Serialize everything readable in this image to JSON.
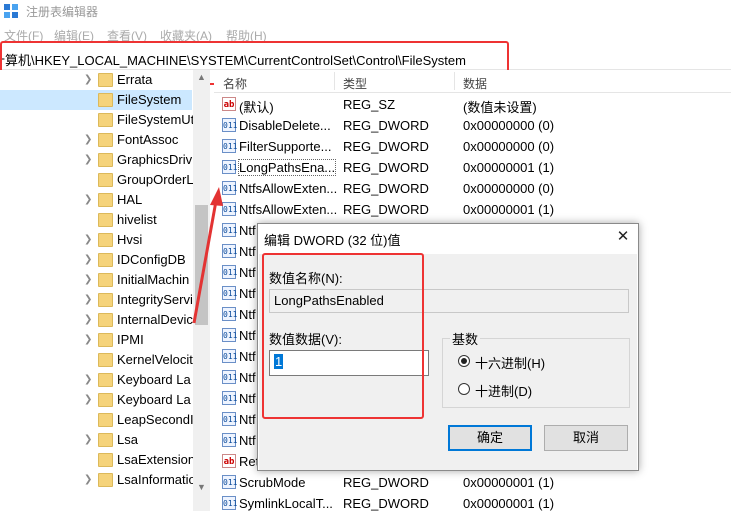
{
  "window": {
    "title": "注册表编辑器",
    "menu": [
      "文件(F)",
      "编辑(E)",
      "查看(V)",
      "收藏夹(A)",
      "帮助(H)"
    ]
  },
  "address": {
    "path": "计算机\\HKEY_LOCAL_MACHINE\\SYSTEM\\CurrentControlSet\\Control\\FileSystem"
  },
  "tree": {
    "items": [
      {
        "label": "Errata"
      },
      {
        "label": "FileSystem"
      },
      {
        "label": "FileSystemUti"
      },
      {
        "label": "FontAssoc"
      },
      {
        "label": "GraphicsDriv"
      },
      {
        "label": "GroupOrderL"
      },
      {
        "label": "HAL"
      },
      {
        "label": "hivelist"
      },
      {
        "label": "Hvsi"
      },
      {
        "label": "IDConfigDB"
      },
      {
        "label": "InitialMachin"
      },
      {
        "label": "IntegrityServi"
      },
      {
        "label": "InternalDevic"
      },
      {
        "label": "IPMI"
      },
      {
        "label": "KernelVelocit"
      },
      {
        "label": "Keyboard La"
      },
      {
        "label": "Keyboard La"
      },
      {
        "label": "LeapSecondI"
      },
      {
        "label": "Lsa"
      },
      {
        "label": "LsaExtension"
      },
      {
        "label": "LsaInformatio"
      }
    ]
  },
  "list": {
    "headers": {
      "name": "名称",
      "type": "类型",
      "data": "数据"
    },
    "rows": [
      {
        "icon": "ab",
        "name": "(默认)",
        "type": "REG_SZ",
        "data": "(数值未设置)"
      },
      {
        "icon": "dword",
        "name": "DisableDelete...",
        "type": "REG_DWORD",
        "data": "0x00000000 (0)"
      },
      {
        "icon": "dword",
        "name": "FilterSupporte...",
        "type": "REG_DWORD",
        "data": "0x00000000 (0)"
      },
      {
        "icon": "dword",
        "name": "LongPathsEna...",
        "type": "REG_DWORD",
        "data": "0x00000001 (1)"
      },
      {
        "icon": "dword",
        "name": "NtfsAllowExten...",
        "type": "REG_DWORD",
        "data": "0x00000000 (0)"
      },
      {
        "icon": "dword",
        "name": "NtfsAllowExten...",
        "type": "REG_DWORD",
        "data": "0x00000001 (1)"
      },
      {
        "icon": "dword",
        "name": "Ntf",
        "type": "",
        "data": ""
      },
      {
        "icon": "dword",
        "name": "Ntf",
        "type": "",
        "data": ""
      },
      {
        "icon": "dword",
        "name": "Ntf",
        "type": "",
        "data": ""
      },
      {
        "icon": "dword",
        "name": "Ntf",
        "type": "",
        "data": ""
      },
      {
        "icon": "dword",
        "name": "Ntf",
        "type": "",
        "data": ""
      },
      {
        "icon": "dword",
        "name": "Ntf",
        "type": "",
        "data": ""
      },
      {
        "icon": "dword",
        "name": "Ntf",
        "type": "",
        "data": ""
      },
      {
        "icon": "dword",
        "name": "Ntf",
        "type": "",
        "data": ""
      },
      {
        "icon": "dword",
        "name": "Ntf",
        "type": "",
        "data": ""
      },
      {
        "icon": "dword",
        "name": "Ntf",
        "type": "",
        "data": ""
      },
      {
        "icon": "dword",
        "name": "Ntf",
        "type": "",
        "data": ""
      },
      {
        "icon": "ab",
        "name": "Ret",
        "type": "",
        "data": ""
      },
      {
        "icon": "dword",
        "name": "ScrubMode",
        "type": "REG_DWORD",
        "data": "0x00000001 (1)"
      },
      {
        "icon": "dword",
        "name": "SymlinkLocalT...",
        "type": "REG_DWORD",
        "data": "0x00000001 (1)"
      }
    ]
  },
  "dialog": {
    "title": "编辑 DWORD (32 位)值",
    "name_label": "数值名称(N):",
    "name_value": "LongPathsEnabled",
    "data_label": "数值数据(V):",
    "data_value": "1",
    "base_label": "基数",
    "hex_label": "十六进制(H)",
    "dec_label": "十进制(D)",
    "ok": "确定",
    "cancel": "取消",
    "base_selected": "hex"
  },
  "colors": {
    "highlight": "#e33333",
    "selection": "#cce8ff",
    "accent": "#0078d7"
  }
}
